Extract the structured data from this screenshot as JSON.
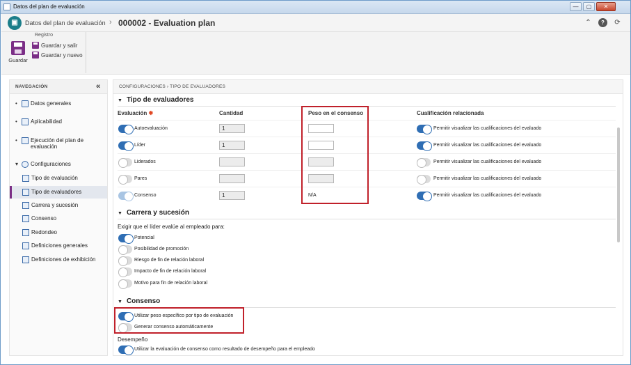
{
  "window": {
    "title": "Datos del plan de evaluación",
    "min": "—",
    "max": "▢",
    "close": "✕"
  },
  "header": {
    "breadcrumb_root": "Datos del plan de evaluación",
    "separator": "›",
    "plan_title": "000002 - Evaluation plan",
    "collapse_icon": "⌃",
    "help_icon": "?",
    "refresh_icon": "⟳"
  },
  "ribbon": {
    "group_label": "Registro",
    "save": "Guardar",
    "save_exit": "Guardar y salir",
    "save_new": "Guardar y nuevo"
  },
  "nav": {
    "title": "NAVEGACIÓN",
    "collapse": "«",
    "items": [
      {
        "label": "Datos generales"
      },
      {
        "label": "Aplicabilidad"
      },
      {
        "label": "Ejecución del plan de evaluación"
      },
      {
        "label": "Configuraciones"
      },
      {
        "label": "Tipo de evaluación"
      },
      {
        "label": "Tipo de evaluadores",
        "selected": true
      },
      {
        "label": "Carrera y sucesión"
      },
      {
        "label": "Consenso"
      },
      {
        "label": "Redondeo"
      },
      {
        "label": "Definiciones generales"
      },
      {
        "label": "Definiciones de exhibición"
      }
    ]
  },
  "content": {
    "breadcrumb": "CONFIGURACIONES  ›  TIPO DE EVALUADORES",
    "evaluators": {
      "section_title": "Tipo de evaluadores",
      "columns": {
        "evaluation": "Evaluación",
        "quantity": "Cantidad",
        "weight": "Peso en el consenso",
        "qualification": "Cualificación relacionada"
      },
      "required_mark": "✱",
      "rows": [
        {
          "label": "Autoevaluación",
          "enabled": true,
          "quantity": "1",
          "weight": "",
          "qual_on": true,
          "qual_label": "Permitir visualizar las cualificaciones del evaluado"
        },
        {
          "label": "Líder",
          "enabled": true,
          "quantity": "1",
          "weight": "",
          "qual_on": true,
          "qual_label": "Permitir visualizar las cualificaciones del evaluado"
        },
        {
          "label": "Liderados",
          "enabled": false,
          "quantity": "",
          "weight": "",
          "qual_on": false,
          "qual_label": "Permitir visualizar las cualificaciones del evaluado"
        },
        {
          "label": "Pares",
          "enabled": false,
          "quantity": "",
          "weight": "",
          "qual_on": false,
          "qual_label": "Permitir visualizar las cualificaciones del evaluado"
        },
        {
          "label": "Consenso",
          "enabled": true,
          "quantity": "1",
          "weight": "N/A",
          "qual_on": true,
          "qual_label": "Permitir visualizar las cualificaciones del evaluado"
        }
      ]
    },
    "career": {
      "section_title": "Carrera y sucesión",
      "prompt": "Exigir que el líder evalúe al empleado para:",
      "options": [
        {
          "label": "Potencial",
          "on": true
        },
        {
          "label": "Posibilidad de promoción",
          "on": false
        },
        {
          "label": "Riesgo de fin de relación laboral",
          "on": false
        },
        {
          "label": "Impacto de fin de relación laboral",
          "on": false
        },
        {
          "label": "Motivo para fin de relación laboral",
          "on": false
        }
      ]
    },
    "consensus": {
      "section_title": "Consenso",
      "options": [
        {
          "label": "Utilizar peso específico por tipo de evaluación",
          "on": true
        },
        {
          "label": "Generar consenso automáticamente",
          "on": false
        }
      ],
      "performance_label": "Desempeño",
      "performance_option": {
        "label": "Utilizar la evaluación de consenso como resultado de desempeño para el empleado",
        "on": true
      }
    }
  },
  "colors": {
    "accent": "#7b2e86",
    "toggle_on": "#2f6eb4",
    "highlight": "#c0202a"
  }
}
